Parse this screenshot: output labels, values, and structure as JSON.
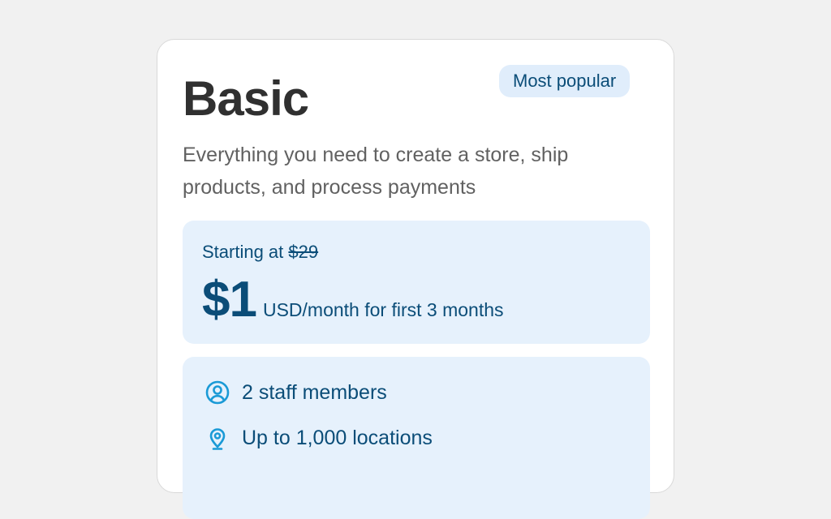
{
  "plan": {
    "title": "Basic",
    "badge": "Most popular",
    "description": "Everything you need to create a store, ship products, and process payments"
  },
  "pricing": {
    "starting_prefix": "Starting at",
    "original_price": "$29",
    "price": "$1",
    "period": "USD/month for first 3 months"
  },
  "features": [
    {
      "icon": "user-circle-icon",
      "label": "2 staff members"
    },
    {
      "icon": "location-pin-icon",
      "label": "Up to 1,000 locations"
    }
  ],
  "colors": {
    "accent_text": "#0b4d78",
    "accent_bg": "#e6f1fc",
    "badge_bg": "#e0edfb",
    "icon": "#1a9ad6",
    "title": "#303030",
    "body_text": "#616161"
  }
}
